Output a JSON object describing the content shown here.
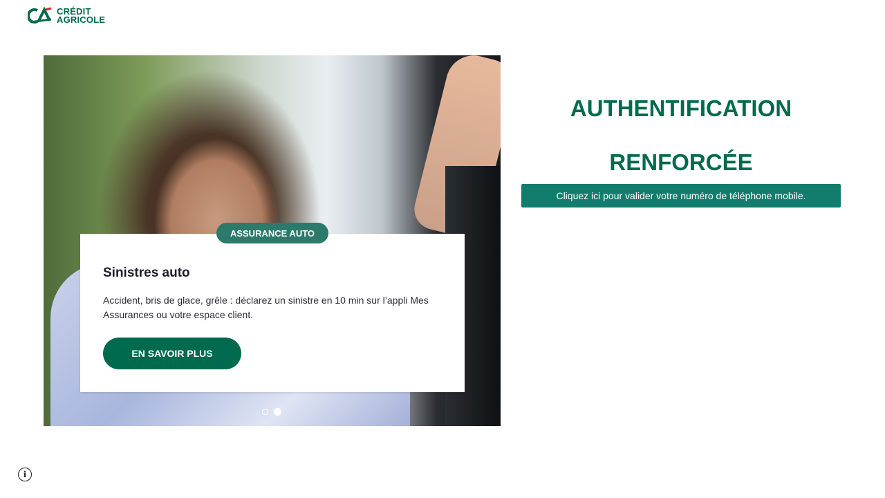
{
  "header": {
    "brand_line1": "CRÉDIT",
    "brand_line2": "AGRICOLE",
    "logo_icon": "credit-agricole-logo"
  },
  "carousel": {
    "tag": "ASSURANCE AUTO",
    "title": "Sinistres auto",
    "body": "Accident, bris de glace, grêle : déclarez un sinistre en 10 min sur l’appli Mes Assurances ou votre espace client.",
    "cta_label": "EN SAVOIR PLUS",
    "slide_count": 2,
    "active_slide": 2
  },
  "auth": {
    "title_line1": "AUTHENTIFICATION",
    "title_line2": "RENFORCÉE",
    "validate_label": "Cliquez ici pour valider votre numéro de téléphone mobile."
  },
  "footer": {
    "info_icon": "info-icon"
  },
  "colors": {
    "brand_green": "#006a4e",
    "teal_button": "#127d6c",
    "tag_green": "#2c7a6b",
    "text_dark": "#1d1d2b"
  }
}
